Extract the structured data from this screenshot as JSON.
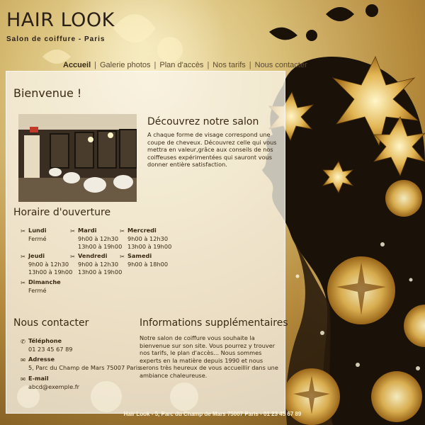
{
  "brand": {
    "title": "HAIR LOOK",
    "subtitle": "Salon de coiffure - Paris"
  },
  "nav": {
    "items": [
      "Accueil",
      "Galerie photos",
      "Plan d'accès",
      "Nos tarifs",
      "Nous contacter"
    ],
    "active": "Accueil",
    "separator": "|"
  },
  "welcome": {
    "heading": "Bienvenue !"
  },
  "discover": {
    "heading": "Découvrez notre salon",
    "text": "A chaque forme de visage correspond une coupe de cheveux. Découvrez celle qui vous mettra en valeur,grâce aux conseils de nos coiffeuses expérimentées qui sauront vous donner entière satisfaction."
  },
  "hours": {
    "heading": "Horaire d'ouverture",
    "days": [
      {
        "day": "Lundi",
        "lines": [
          "Fermé"
        ]
      },
      {
        "day": "Mardi",
        "lines": [
          "9h00 à 12h30",
          "13h00 à 19h00"
        ]
      },
      {
        "day": "Mercredi",
        "lines": [
          "9h00 à 12h30",
          "13h00 à 19h00"
        ]
      },
      {
        "day": "Jeudi",
        "lines": [
          "9h00 à 12h30",
          "13h00 à 19h00"
        ]
      },
      {
        "day": "Vendredi",
        "lines": [
          "9h00 à 12h30",
          "13h00 à 19h00"
        ]
      },
      {
        "day": "Samedi",
        "lines": [
          "9h00 à 18h00"
        ]
      },
      {
        "day": "Dimanche",
        "lines": [
          "Fermé"
        ]
      }
    ]
  },
  "contact": {
    "heading": "Nous contacter",
    "items": [
      {
        "label": "Téléphone",
        "value": "01 23 45 67 89"
      },
      {
        "label": "Adresse",
        "value": "5, Parc du Champ de Mars 75007 Paris"
      },
      {
        "label": "E-mail",
        "value": "abcd@exemple.fr"
      }
    ]
  },
  "info": {
    "heading": "Informations supplémentaires",
    "text": "Notre salon de coiffure vous souhaite la bienvenue sur son site. Vous pourrez y trouver nos tarifs, le plan d'accès... Nous sommes experts en la matière depuis 1990 et nous serons très heureux de vous accueillir dans une ambiance chaleureuse."
  },
  "footer": {
    "text": "Hair Look - 5, Parc du Champ de Mars 75007 Paris - 01 23 45 67 89"
  },
  "colors": {
    "text": "#3a2a14",
    "panel": "#f8f4e8",
    "gold": "#d4a84a",
    "dark": "#1a1208"
  }
}
